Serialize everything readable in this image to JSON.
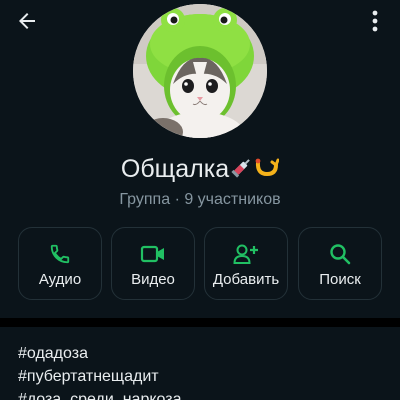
{
  "header": {
    "back_icon": "arrow-left-icon",
    "menu_icon": "more-vertical-icon"
  },
  "profile": {
    "avatar_description": "kitten-in-frog-hat",
    "name": "Общалка",
    "name_emojis": [
      "syringe-emoji",
      "hook-emoji"
    ],
    "meta": "Группа · 9 участников"
  },
  "actions": [
    {
      "label": "Аудио",
      "icon": "phone-icon"
    },
    {
      "label": "Видео",
      "icon": "video-camera-icon"
    },
    {
      "label": "Добавить",
      "icon": "add-person-icon"
    },
    {
      "label": "Поиск",
      "icon": "search-icon"
    }
  ],
  "description": {
    "lines": [
      "#одадоза",
      "#пубертатнещадит",
      "#доза_среди_наркоза"
    ]
  },
  "colors": {
    "background": "#0b141a",
    "accent": "#21c063",
    "text_primary": "#e9edef",
    "text_secondary": "#8696a0",
    "border": "#233138"
  }
}
